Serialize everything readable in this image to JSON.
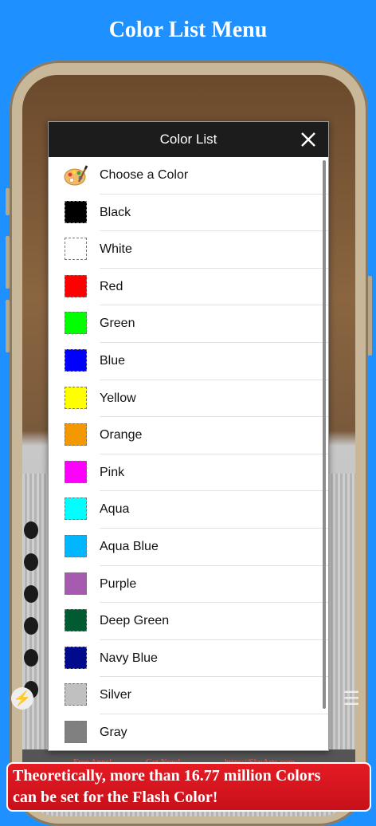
{
  "promo": {
    "title": "Color List Menu",
    "banner_line1": "Theoretically, more than 16.77 million Colors",
    "banner_line2": "can be set for the Flash Color!"
  },
  "app_behind": {
    "ad_text_1": "Free Apps!",
    "ad_text_2": "Get Now!",
    "ad_text_3": "https://SkyArts.com"
  },
  "dialog": {
    "title": "Color List",
    "header_item": {
      "label": "Choose a Color",
      "icon": "palette-icon"
    },
    "items": [
      {
        "label": "Black",
        "color": "#000000"
      },
      {
        "label": "White",
        "color": "#FFFFFF"
      },
      {
        "label": "Red",
        "color": "#FF0000"
      },
      {
        "label": "Green",
        "color": "#00FF00"
      },
      {
        "label": "Blue",
        "color": "#0000FF"
      },
      {
        "label": "Yellow",
        "color": "#FFFF00"
      },
      {
        "label": "Orange",
        "color": "#F39800"
      },
      {
        "label": "Pink",
        "color": "#FF00FF"
      },
      {
        "label": "Aqua",
        "color": "#00FFFF"
      },
      {
        "label": "Aqua Blue",
        "color": "#00B7FF"
      },
      {
        "label": "Purple",
        "color": "#A65AB0"
      },
      {
        "label": "Deep Green",
        "color": "#005A32"
      },
      {
        "label": "Navy Blue",
        "color": "#000A8C"
      },
      {
        "label": "Silver",
        "color": "#C0C0C0"
      },
      {
        "label": "Gray",
        "color": "#808080"
      }
    ]
  }
}
